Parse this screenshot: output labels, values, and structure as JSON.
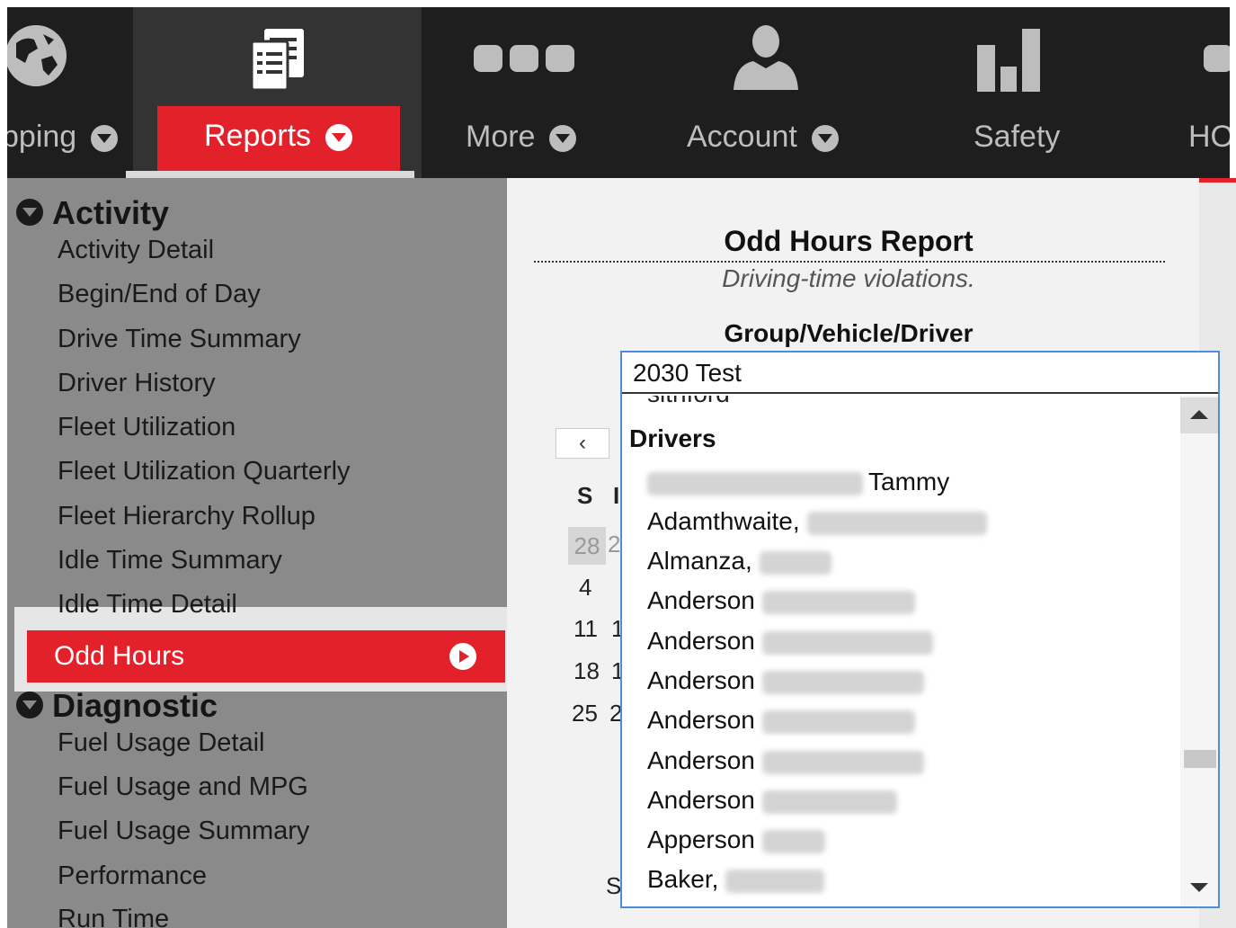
{
  "nav": {
    "items": [
      {
        "label": "pping"
      },
      {
        "label": "Reports"
      },
      {
        "label": "More"
      },
      {
        "label": "Account"
      },
      {
        "label": "Safety"
      },
      {
        "label": "HO"
      }
    ]
  },
  "sidebar": {
    "activity": {
      "title": "Activity",
      "items": [
        "Activity Detail",
        "Begin/End of Day",
        "Drive Time Summary",
        "Driver History",
        "Fleet Utilization",
        "Fleet Utilization Quarterly",
        "Fleet Hierarchy Rollup",
        "Idle Time Summary",
        "Idle Time Detail"
      ]
    },
    "selected": "Odd Hours",
    "diagnostic": {
      "title": "Diagnostic",
      "items": [
        "Fuel Usage Detail",
        "Fuel Usage and MPG",
        "Fuel Usage Summary",
        "Performance",
        "Run Time"
      ]
    }
  },
  "report": {
    "title": "Odd Hours Report",
    "subtitle": "Driving-time violations.",
    "group_label": "Group/Vehicle/Driver"
  },
  "calendar": {
    "prev": "‹",
    "day_headers": [
      "S",
      "I"
    ],
    "rows": [
      "28",
      "4",
      "11",
      "18",
      "25"
    ],
    "partial": [
      "2",
      "1",
      "1",
      "2"
    ],
    "footer": "S"
  },
  "dropdown": {
    "value": "2030 Test",
    "clipped": "sithford",
    "group": "Drivers",
    "options": [
      "Tammy",
      "Adamthwaite,",
      "Almanza,",
      "Anderson",
      "Anderson",
      "Anderson",
      "Anderson",
      "Anderson",
      "Anderson",
      "Apperson",
      "Baker,"
    ]
  },
  "colors": {
    "accent": "#e3212b",
    "nav_bg": "#1e1e1e",
    "sidebar_bg": "#8a8a8a",
    "focus": "#4a90d9"
  }
}
